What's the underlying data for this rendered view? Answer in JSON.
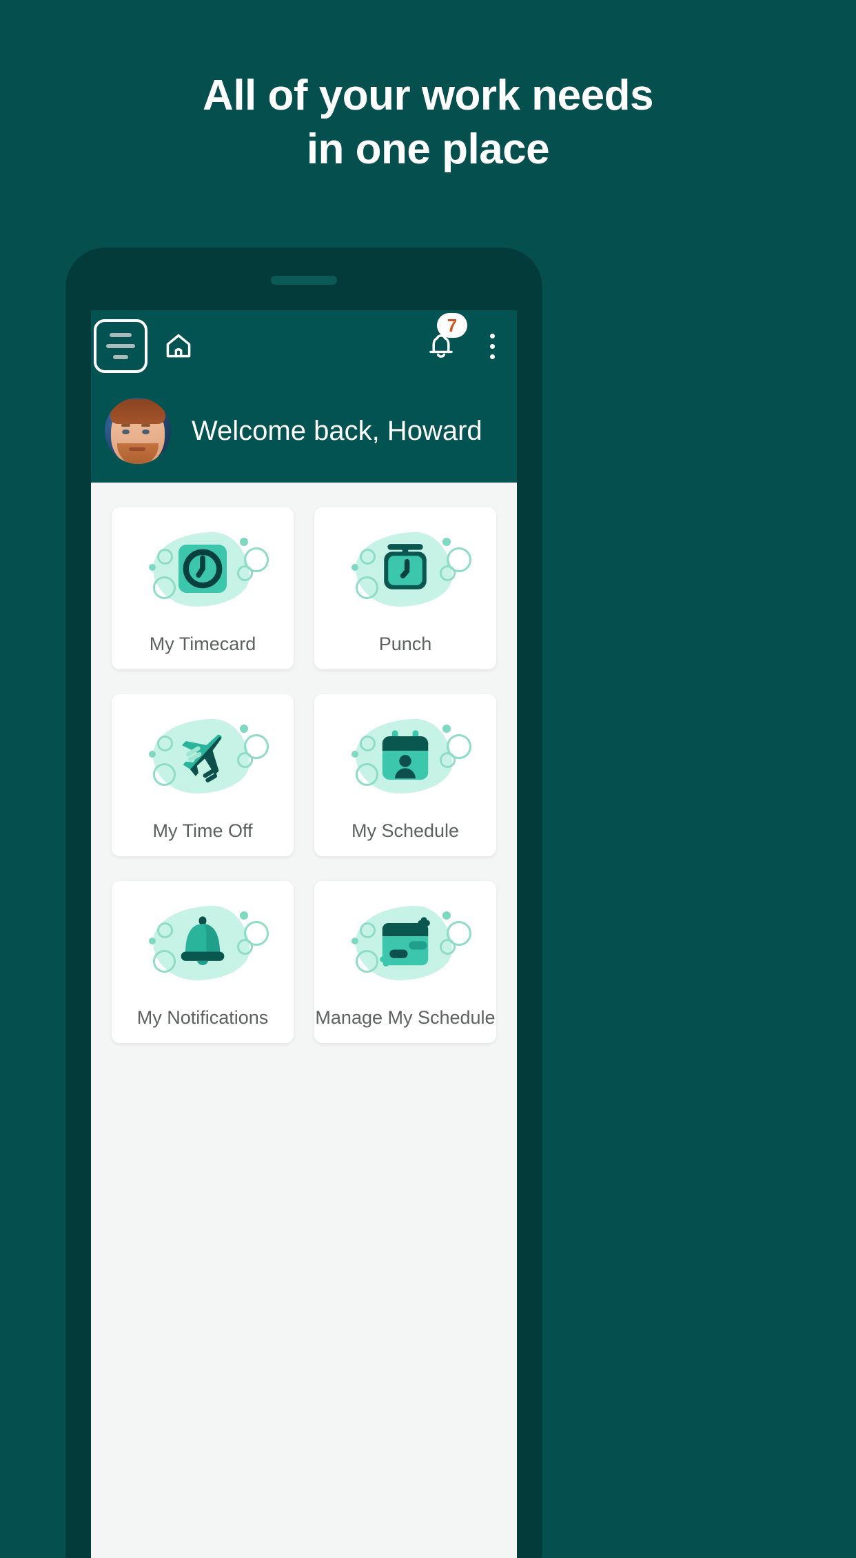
{
  "hero": {
    "line1": "All of your work needs",
    "line2": "in one place"
  },
  "colors": {
    "background": "#064f4f",
    "phone_frame": "#033b3b",
    "appbar": "#035352",
    "screen_bg": "#f4f5f5",
    "card_bg": "#ffffff",
    "accent_teal": "#3cc7ac",
    "accent_dark_teal": "#0a5750",
    "blob_mint": "#bdf0e2",
    "badge_text": "#d2541d",
    "label_text": "#5d6160"
  },
  "appbar": {
    "menu_icon": "hamburger-menu-icon",
    "home_icon": "home-icon",
    "bell_icon": "bell-icon",
    "notification_count": "7",
    "overflow_icon": "kebab-menu-icon"
  },
  "welcome": {
    "avatar": "user-avatar",
    "greeting": "Welcome back, Howard"
  },
  "cards": [
    {
      "label": "My Timecard",
      "icon": "clock-square-icon"
    },
    {
      "label": "Punch",
      "icon": "punch-clock-icon"
    },
    {
      "label": "My Time Off",
      "icon": "airplane-icon"
    },
    {
      "label": "My Schedule",
      "icon": "calendar-person-icon"
    },
    {
      "label": "My Notifications",
      "icon": "bell-icon"
    },
    {
      "label": "Manage My Schedule",
      "icon": "calendar-manage-icon"
    }
  ]
}
